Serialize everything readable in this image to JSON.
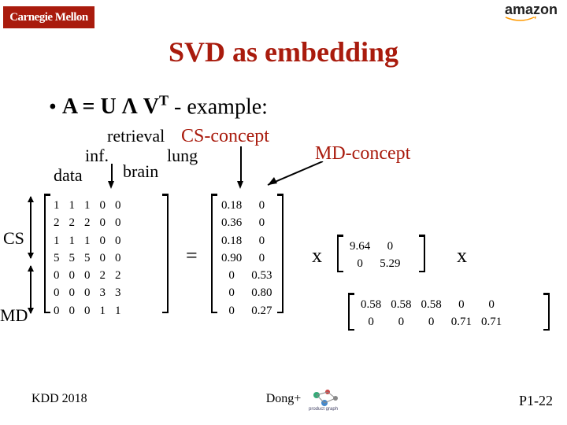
{
  "logos": {
    "cmu": "Carnegie Mellon",
    "amazon": "amazon"
  },
  "title": "SVD as embedding",
  "bullet": {
    "prefix": "•  ",
    "text_a": "A = U ",
    "lambda": "Λ",
    "text_b": " V",
    "sup": "T",
    "tail": " - example:"
  },
  "col_labels": {
    "data": "data",
    "inf": "inf.",
    "retrieval": "retrieval",
    "brain": "brain",
    "lung": "lung"
  },
  "concepts": {
    "cs": "CS-concept",
    "md": "MD-concept"
  },
  "side": {
    "cs": "CS",
    "md": "MD"
  },
  "ops": {
    "eq": "=",
    "x1": "x",
    "x2": "x"
  },
  "A": [
    [
      1,
      1,
      1,
      0,
      0
    ],
    [
      2,
      2,
      2,
      0,
      0
    ],
    [
      1,
      1,
      1,
      0,
      0
    ],
    [
      5,
      5,
      5,
      0,
      0
    ],
    [
      0,
      0,
      0,
      2,
      2
    ],
    [
      0,
      0,
      0,
      3,
      3
    ],
    [
      0,
      0,
      0,
      1,
      1
    ]
  ],
  "U": [
    [
      "0.18",
      "0"
    ],
    [
      "0.36",
      "0"
    ],
    [
      "0.18",
      "0"
    ],
    [
      "0.90",
      "0"
    ],
    [
      "0",
      "0.53"
    ],
    [
      "0",
      "0.80"
    ],
    [
      "0",
      "0.27"
    ]
  ],
  "S": [
    [
      "9.64",
      "0"
    ],
    [
      "0",
      "5.29"
    ]
  ],
  "Vt": [
    [
      "0.58",
      "0.58",
      "0.58",
      "0",
      "0"
    ],
    [
      "0",
      "0",
      "0",
      "0.71",
      "0.71"
    ]
  ],
  "footer": {
    "left": "KDD 2018",
    "center": "Dong+",
    "right": "P1-22"
  }
}
